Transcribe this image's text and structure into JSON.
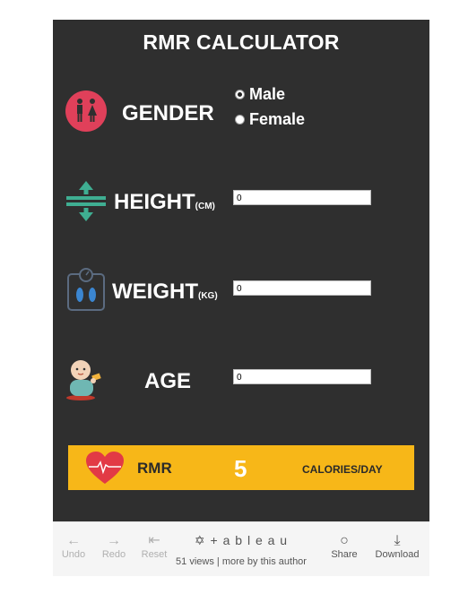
{
  "title": "RMR CALCULATOR",
  "gender": {
    "label": "GENDER",
    "options": [
      {
        "label": "Male",
        "selected": true
      },
      {
        "label": "Female",
        "selected": false
      }
    ]
  },
  "height": {
    "label": "HEIGHT",
    "unit": "(CM)",
    "value": "0"
  },
  "weight": {
    "label": "WEIGHT",
    "unit": "(KG)",
    "value": "0"
  },
  "age": {
    "label": "AGE",
    "value": "0"
  },
  "result": {
    "label": "RMR",
    "value": "5",
    "unit": "CALORIES/DAY"
  },
  "toolbar": {
    "undo": "Undo",
    "redo": "Redo",
    "reset": "Reset",
    "brand": "+ a b l e a u",
    "views": "51 views",
    "separator": "|",
    "more": "more by this author",
    "share": "Share",
    "download": "Download"
  },
  "colors": {
    "background": "#2f2f2f",
    "result_bar": "#f7b718",
    "gender_icon": "#e0405a",
    "height_icon": "#3fae92",
    "heart": "#e23a45"
  }
}
